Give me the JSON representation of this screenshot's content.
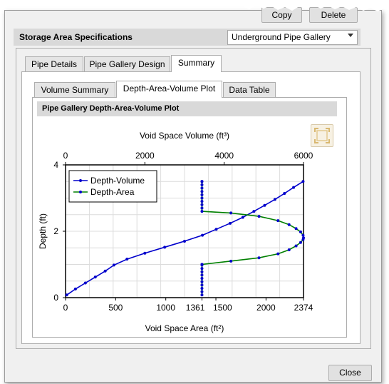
{
  "top_buttons": {
    "copy_label": "Copy",
    "delete_label": "Delete"
  },
  "header": {
    "title": "Storage Area Specifications",
    "dropdown_value": "Underground Pipe Gallery"
  },
  "tabs": [
    {
      "label": "Pipe Details",
      "active": false
    },
    {
      "label": "Pipe Gallery Design",
      "active": false
    },
    {
      "label": "Summary",
      "active": true
    }
  ],
  "subtabs": [
    {
      "label": "Volume Summary",
      "active": false
    },
    {
      "label": "Depth-Area-Volume Plot",
      "active": true
    },
    {
      "label": "Data Table",
      "active": false
    }
  ],
  "plot_panel": {
    "title": "Pipe Gallery Depth-Area-Volume Plot",
    "expand_icon": "expand-icon"
  },
  "chart_data": {
    "type": "line",
    "xlabel_bottom": "Void Space Area (ft²)",
    "xlabel_top": "Void Space Volume (ft³)",
    "ylabel": "Depth (ft)",
    "x_bottom_ticks": [
      "0",
      "500",
      "1000",
      "1361",
      "1500",
      "2000",
      "2374"
    ],
    "x_top_ticks": [
      "0",
      "2000",
      "4000",
      "6000"
    ],
    "y_ticks": [
      "0",
      "2",
      "4"
    ],
    "ylim": [
      0,
      4
    ],
    "xlim_bottom": [
      0,
      2374
    ],
    "xlim_top": [
      0,
      6000
    ],
    "grid": true,
    "legend_position": "top-left",
    "series": [
      {
        "name": "Depth-Volume",
        "color": "#0000cc",
        "axis": "top",
        "x": [
          30,
          250,
          500,
          750,
          1000,
          1220,
          1550,
          2000,
          2500,
          3000,
          3450,
          3800,
          4150,
          4470,
          4750,
          5020,
          5280,
          5520,
          5750,
          5990
        ],
        "y": [
          0.08,
          0.26,
          0.44,
          0.62,
          0.8,
          0.98,
          1.16,
          1.34,
          1.52,
          1.7,
          1.88,
          2.06,
          2.24,
          2.42,
          2.6,
          2.78,
          2.96,
          3.14,
          3.32,
          3.5
        ]
      },
      {
        "name": "Depth-Area",
        "color": "#008000",
        "axis": "bottom",
        "x": [
          1361,
          1361,
          1361,
          1361,
          1361,
          1361,
          1361,
          1361,
          1361,
          1361,
          1361,
          1361,
          1361,
          1650,
          1930,
          2120,
          2230,
          2300,
          2345,
          2370,
          2374,
          2370,
          2345,
          2300,
          2230,
          2120,
          1930,
          1650,
          1361,
          1361,
          1361,
          1361,
          1361,
          1361,
          1361,
          1361,
          1361,
          1361,
          1361
        ],
        "y": [
          0.08,
          0.18,
          0.28,
          0.38,
          0.48,
          0.58,
          0.68,
          0.78,
          0.88,
          0.98,
          1.0,
          1.0,
          1.0,
          1.1,
          1.2,
          1.32,
          1.44,
          1.56,
          1.66,
          1.75,
          1.8,
          1.88,
          1.98,
          2.08,
          2.2,
          2.32,
          2.45,
          2.55,
          2.6,
          2.7,
          2.8,
          2.9,
          3.0,
          3.1,
          3.2,
          3.3,
          3.4,
          3.5,
          3.5
        ]
      }
    ]
  },
  "footer": {
    "close_label": "Close"
  }
}
